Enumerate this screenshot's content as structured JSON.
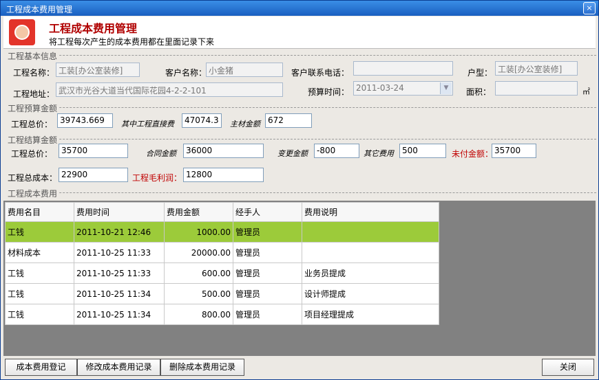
{
  "window": {
    "title": "工程成本费用管理"
  },
  "header": {
    "title": "工程成本费用管理",
    "subtitle": "将工程每次产生的成本费用都在里面记录下来"
  },
  "basic": {
    "section": "工程基本信息",
    "name_label": "工程名称：",
    "name_value": "工装[办公室装修]",
    "client_label": "客户名称：",
    "client_value": "小金猪",
    "phone_label": "客户联系电话：",
    "phone_value": "",
    "type_label": "户型：",
    "type_value": "工装[办公室装修]",
    "address_label": "工程地址：",
    "address_value": "武汉市光谷大道当代国际花园4-2-2-101",
    "date_label": "预算时间：",
    "date_value": "2011-03-24",
    "area_label": "面积：",
    "area_value": "",
    "area_unit": "㎡"
  },
  "budget": {
    "section": "工程预算金额",
    "total_label": "工程总价：",
    "total_value": "39743.669",
    "direct_label": "其中工程直接费",
    "direct_value": "47074.3",
    "main_label": "主材金额",
    "main_value": "672"
  },
  "settle": {
    "section": "工程结算金额",
    "total_label": "工程总价：",
    "total_value": "35700",
    "contract_label": "合同金额",
    "contract_value": "36000",
    "change_label": "变更金额",
    "change_value": "-800",
    "other_label": "其它费用",
    "other_value": "500",
    "unpaid_label": "未付金额：",
    "unpaid_value": "35700",
    "cost_label": "工程总成本：",
    "cost_value": "22900",
    "profit_label": "工程毛利润：",
    "profit_value": "12800"
  },
  "costs": {
    "section": "工程成本费用",
    "columns": [
      "费用名目",
      "费用时间",
      "费用金额",
      "经手人",
      "费用说明"
    ],
    "rows": [
      [
        "工钱",
        "2011-10-21 12:46",
        "1000.00",
        "管理员",
        ""
      ],
      [
        "材料成本",
        "2011-10-25 11:33",
        "20000.00",
        "管理员",
        ""
      ],
      [
        "工钱",
        "2011-10-25 11:33",
        "600.00",
        "管理员",
        "业务员提成"
      ],
      [
        "工钱",
        "2011-10-25 11:34",
        "500.00",
        "管理员",
        "设计师提成"
      ],
      [
        "工钱",
        "2011-10-25 11:34",
        "800.00",
        "管理员",
        "项目经理提成"
      ]
    ],
    "selected_row": 0
  },
  "buttons": {
    "register": "成本费用登记",
    "edit": "修改成本费用记录",
    "delete": "删除成本费用记录",
    "close": "关闭"
  }
}
